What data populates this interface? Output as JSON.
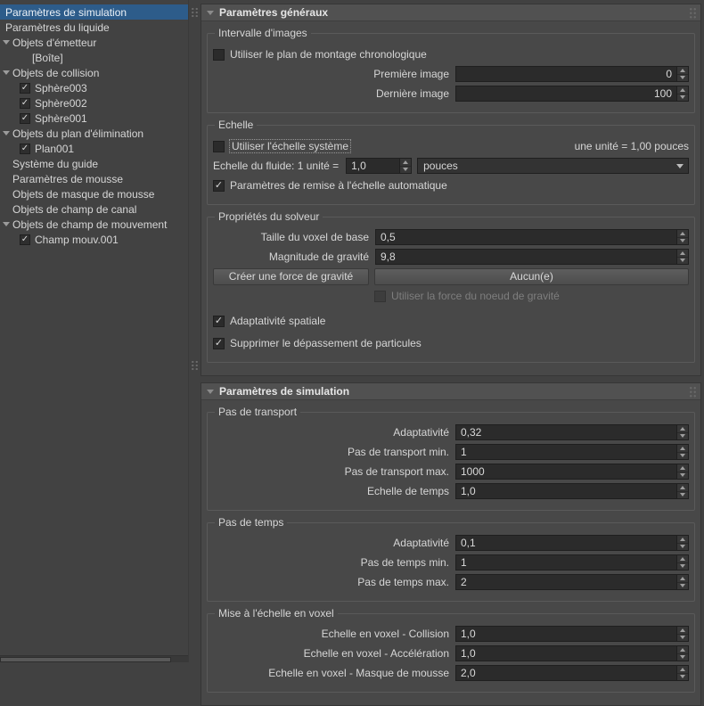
{
  "icons": {
    "checkmark": "✓"
  },
  "sidebar": {
    "items": [
      {
        "label": "Paramètres de simulation"
      },
      {
        "label": "Paramètres du liquide"
      },
      {
        "label": "Objets d'émetteur"
      },
      {
        "label": "[Boîte]"
      },
      {
        "label": "Objets de collision"
      },
      {
        "label": "Sphère003"
      },
      {
        "label": "Sphère002"
      },
      {
        "label": "Sphère001"
      },
      {
        "label": "Objets du plan d'élimination"
      },
      {
        "label": "Plan001"
      },
      {
        "label": "Système du guide"
      },
      {
        "label": "Paramètres de mousse"
      },
      {
        "label": "Objets de masque de mousse"
      },
      {
        "label": "Objets de champ de canal"
      },
      {
        "label": "Objets de champ de mouvement"
      },
      {
        "label": "Champ mouv.001"
      }
    ]
  },
  "general": {
    "title": "Paramètres généraux",
    "frame_range": {
      "group_title": "Intervalle d'images",
      "timeline_checkbox": "Utiliser le plan de montage chronologique",
      "first_frame_label": "Première image",
      "first_frame_value": "0",
      "last_frame_label": "Dernière image",
      "last_frame_value": "100"
    },
    "scale": {
      "group_title": "Echelle",
      "system_scale_checkbox": "Utiliser l'échelle système",
      "unit_info": "une unité = 1,00 pouces",
      "fluid_scale_label": "Echelle du fluide: 1 unité =",
      "fluid_scale_value": "1,0",
      "fluid_scale_unit": "pouces",
      "auto_rescale_checkbox": "Paramètres de remise à l'échelle automatique"
    },
    "solver": {
      "group_title": "Propriétés du solveur",
      "voxel_size_label": "Taille du voxel de base",
      "voxel_size_value": "0,5",
      "gravity_label": "Magnitude de gravité",
      "gravity_value": "9,8",
      "create_gravity_button": "Créer une force de gravité",
      "gravity_node_button": "Aucun(e)",
      "use_gravity_node_checkbox": "Utiliser la force du noeud de gravité",
      "spatial_adaptivity_checkbox": "Adaptativité spatiale",
      "remove_particles_checkbox": "Supprimer le dépassement de particules"
    }
  },
  "simulation": {
    "title": "Paramètres de simulation",
    "transport": {
      "group_title": "Pas de transport",
      "rows": [
        {
          "label": "Adaptativité",
          "value": "0,32"
        },
        {
          "label": "Pas de transport min.",
          "value": "1"
        },
        {
          "label": "Pas de transport max.",
          "value": "1000"
        },
        {
          "label": "Echelle de temps",
          "value": "1,0"
        }
      ]
    },
    "time": {
      "group_title": "Pas de temps",
      "rows": [
        {
          "label": "Adaptativité",
          "value": "0,1"
        },
        {
          "label": "Pas de temps min.",
          "value": "1"
        },
        {
          "label": "Pas de temps max.",
          "value": "2"
        }
      ]
    },
    "voxel": {
      "group_title": "Mise à l'échelle en voxel",
      "rows": [
        {
          "label": "Echelle en voxel - Collision",
          "value": "1,0"
        },
        {
          "label": "Echelle en voxel - Accélération",
          "value": "1,0"
        },
        {
          "label": "Echelle en voxel - Masque de mousse",
          "value": "2,0"
        }
      ]
    }
  }
}
